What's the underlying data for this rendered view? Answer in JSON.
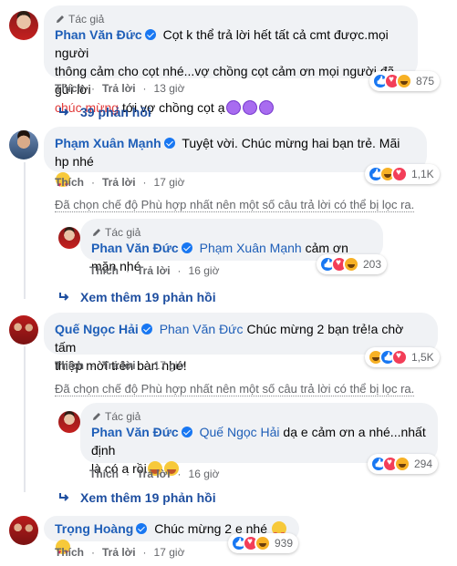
{
  "comments": [
    {
      "author_badge": "Tác giả",
      "name": "Phan Văn Đức",
      "text_line1": "Cọt k thể trả lời hết tất cả cmt được.mọi người",
      "text_line2": "thông cảm cho cọt nhé...vợ chồng cọt cảm ơn mọi người đã gửi lời",
      "highlight": "chúc mừng",
      "text_line3_after": " tới vợ chồng cọt ạ",
      "like": "Thích",
      "reply": "Trả lời",
      "time": "13 giờ",
      "reactions": "875",
      "replies_link": "39 phản hồi"
    },
    {
      "name": "Phạm Xuân Mạnh",
      "text": "Tuyệt vời. Chúc mừng hai bạn trẻ. Mãi hp nhé",
      "like": "Thích",
      "reply": "Trả lời",
      "time": "17 giờ",
      "reactions": "1,1K",
      "filter_note": "Đã chọn chế độ Phù hợp nhất nên một số câu trả lời có thể bị lọc ra.",
      "reply_item": {
        "author_badge": "Tác giả",
        "name": "Phan Văn Đức",
        "tag": "Phạm Xuân Mạnh",
        "text": " cảm ơn mặn nhé",
        "like": "Thích",
        "reply": "Trả lời",
        "time": "16 giờ",
        "reactions": "203"
      },
      "more_replies": "Xem thêm 19 phản hồi"
    },
    {
      "name": "Quế Ngọc Hải",
      "tag": "Phan Văn Đức",
      "text_line1": " Chúc mừng 2 bạn trẻ!a chờ tấm",
      "text_line2": "thiệp mời trên bàn nhé!",
      "like": "Thích",
      "reply": "Trả lời",
      "time": "17 giờ",
      "reactions": "1,5K",
      "filter_note": "Đã chọn chế độ Phù hợp nhất nên một số câu trả lời có thể bị lọc ra.",
      "reply_item": {
        "author_badge": "Tác giả",
        "name": "Phan Văn Đức",
        "tag": "Quế Ngọc Hải",
        "text_line1": " dạ e cảm ơn a nhé...nhất định",
        "text_line2": "là có a rồi",
        "like": "Thích",
        "reply": "Trả lời",
        "time": "16 giờ",
        "reactions": "294"
      },
      "more_replies": "Xem thêm 19 phản hồi"
    },
    {
      "name": "Trọng Hoàng",
      "text": "Chúc mừng 2 e nhé",
      "like": "Thích",
      "reply": "Trả lời",
      "time": "17 giờ",
      "reactions": "939"
    }
  ],
  "colors": {
    "name": "#1f5fb8",
    "highlight": "#e13b3b",
    "bubble": "#f0f2f5",
    "muted": "#65676b"
  }
}
